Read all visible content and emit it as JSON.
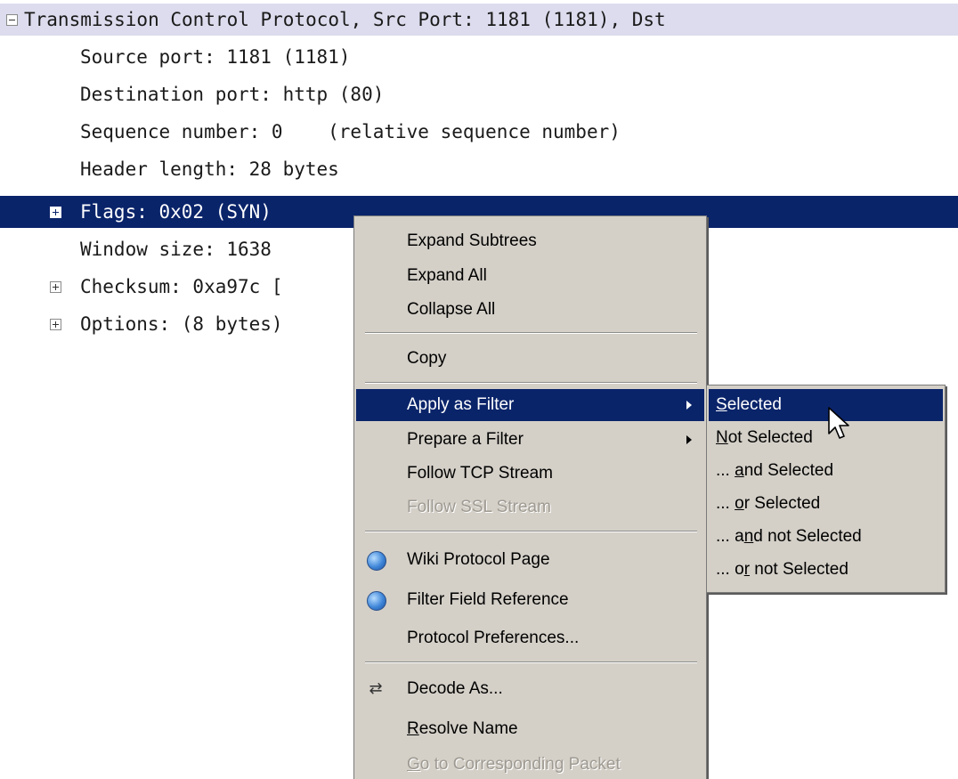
{
  "tree": {
    "header": "Transmission Control Protocol, Src Port: 1181 (1181), Dst",
    "fields": [
      "Source port: 1181 (1181)",
      "Destination port: http (80)",
      "Sequence number: 0    (relative sequence number)",
      "Header length: 28 bytes",
      "Flags: 0x02 (SYN)",
      "Window size: 1638",
      "Checksum: 0xa97c [",
      "Options: (8 bytes)"
    ]
  },
  "context_menu": {
    "expand_subtrees": "Expand Subtrees",
    "expand_all": "Expand All",
    "collapse_all": "Collapse All",
    "copy": "Copy",
    "apply_as_filter": "Apply as Filter",
    "prepare_a_filter": "Prepare a Filter",
    "follow_tcp_stream": "Follow TCP Stream",
    "follow_ssl_stream": "Follow SSL Stream",
    "wiki_protocol_page": "Wiki Protocol Page",
    "filter_field_reference": "Filter Field Reference",
    "protocol_preferences": "Protocol Preferences...",
    "decode_as": "Decode As...",
    "resolve_name": {
      "mnemonic": "R",
      "rest": "esolve Name"
    },
    "go_to_corresponding_packet": {
      "mnemonic": "G",
      "rest": "o to Corresponding Packet"
    }
  },
  "submenu": {
    "selected": {
      "pre": "",
      "mnemonic": "S",
      "post": "elected"
    },
    "not_selected": {
      "pre": "",
      "mnemonic": "N",
      "post": "ot Selected"
    },
    "and_selected": {
      "pre": "... ",
      "mnemonic": "a",
      "post": "nd Selected"
    },
    "or_selected": {
      "pre": "... ",
      "mnemonic": "o",
      "post": "r Selected"
    },
    "and_not_selected": {
      "pre": "... a",
      "mnemonic": "n",
      "post": "d not Selected"
    },
    "or_not_selected": {
      "pre": "... o",
      "mnemonic": "r",
      "post": " not Selected"
    }
  },
  "colors": {
    "selection": "#0a246a",
    "header_row": "#dcdcee",
    "menu_bg": "#d4d0c8"
  },
  "icons": {
    "header_toggle": "minus-box-icon",
    "flags_toggle": "plus-box-icon",
    "wiki": "globe-icon",
    "filter_reference": "globe-icon",
    "decode_as": "decode-icon",
    "cursor": "mouse-pointer-icon"
  }
}
